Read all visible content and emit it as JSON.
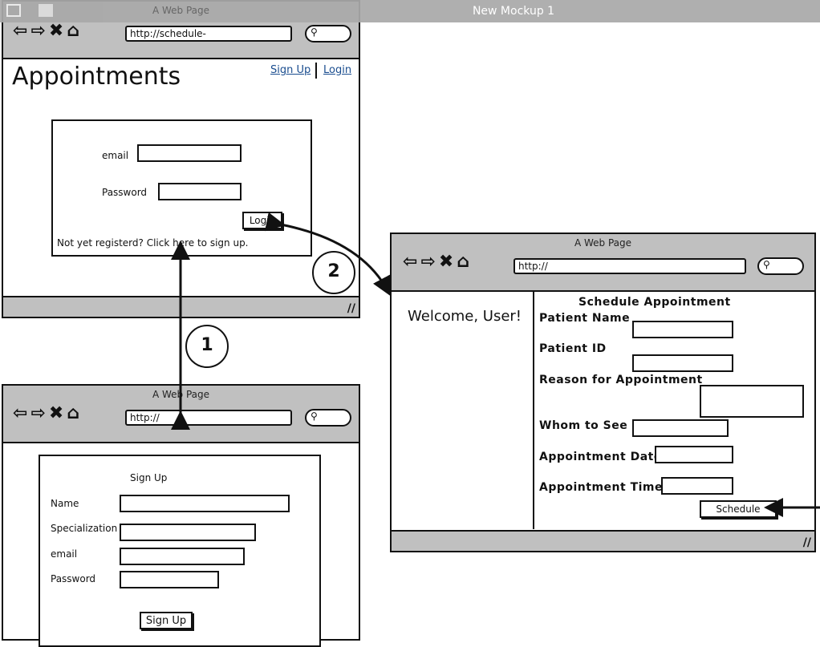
{
  "app": {
    "title": "New Mockup 1"
  },
  "login_page": {
    "window_title": "A Web Page",
    "url": "http://schedule-",
    "heading": "Appointments",
    "links": [
      "Sign Up",
      "Login"
    ],
    "email_label": "email",
    "password_label": "Password",
    "login_button": "Login",
    "signup_hint": "Not yet registerd? Click here to sign up."
  },
  "signup_page": {
    "window_title": "A Web Page",
    "url": "http://",
    "form_title": "Sign Up",
    "fields": [
      "Name",
      "Specialization",
      "email",
      "Password"
    ],
    "submit": "Sign Up"
  },
  "schedule_page": {
    "window_title": "A Web Page",
    "url": "http://",
    "welcome": "Welcome, User!",
    "form_title": "Schedule Appointment",
    "fields": [
      "Patient Name",
      "Patient ID",
      "Reason for Appointment",
      "Whom to See",
      "Appointment Date",
      "Appointment Time"
    ],
    "submit": "Schedule"
  },
  "annotations": {
    "step1": "1",
    "step2": "2"
  }
}
